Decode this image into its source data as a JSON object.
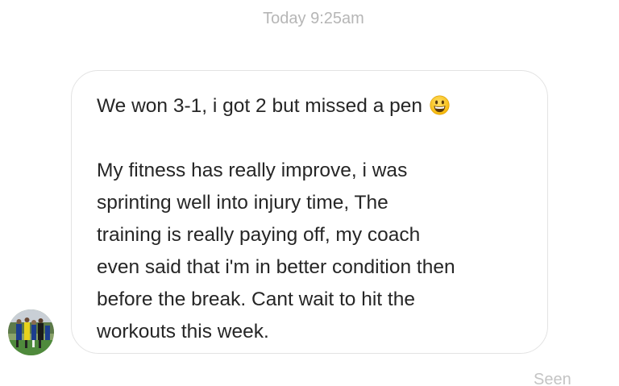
{
  "thread": {
    "timestamp": "Today 9:25am"
  },
  "message": {
    "lines": [
      "We won 3-1, i got 2 but missed a pen",
      "",
      "My fitness has really improve, i was",
      "sprinting well into injury time, The",
      "training is really paying off, my coach",
      "even said that i'm in better condition then",
      "before the break. Cant wait to hit the",
      "workouts this week."
    ],
    "emoji": "grinning-face-emoji"
  },
  "sender": {
    "avatar_icon": "profile-photo-football-team"
  },
  "status": {
    "seen_label": "Seen"
  },
  "colors": {
    "text": "#262626",
    "muted": "#b6b6b6",
    "bubble_border": "#e3e3e3"
  }
}
